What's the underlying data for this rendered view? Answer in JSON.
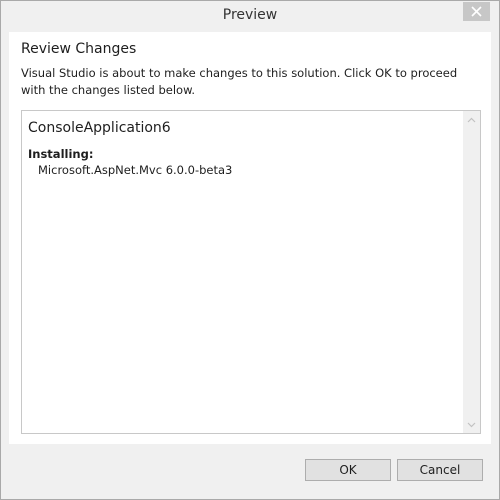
{
  "window": {
    "title": "Preview",
    "close_icon": "close-icon"
  },
  "content": {
    "heading": "Review Changes",
    "description": "Visual Studio is about to make changes to this solution. Click OK to proceed with the changes listed below."
  },
  "changes": {
    "project": "ConsoleApplication6",
    "action_label": "Installing:",
    "packages": [
      "Microsoft.AspNet.Mvc 6.0.0-beta3"
    ]
  },
  "buttons": {
    "ok_label": "OK",
    "cancel_label": "Cancel"
  },
  "colors": {
    "window_background": "#f0f0f0",
    "content_background": "#ffffff",
    "close_button": "#c7c7c7",
    "button_face": "#e1e1e1"
  }
}
